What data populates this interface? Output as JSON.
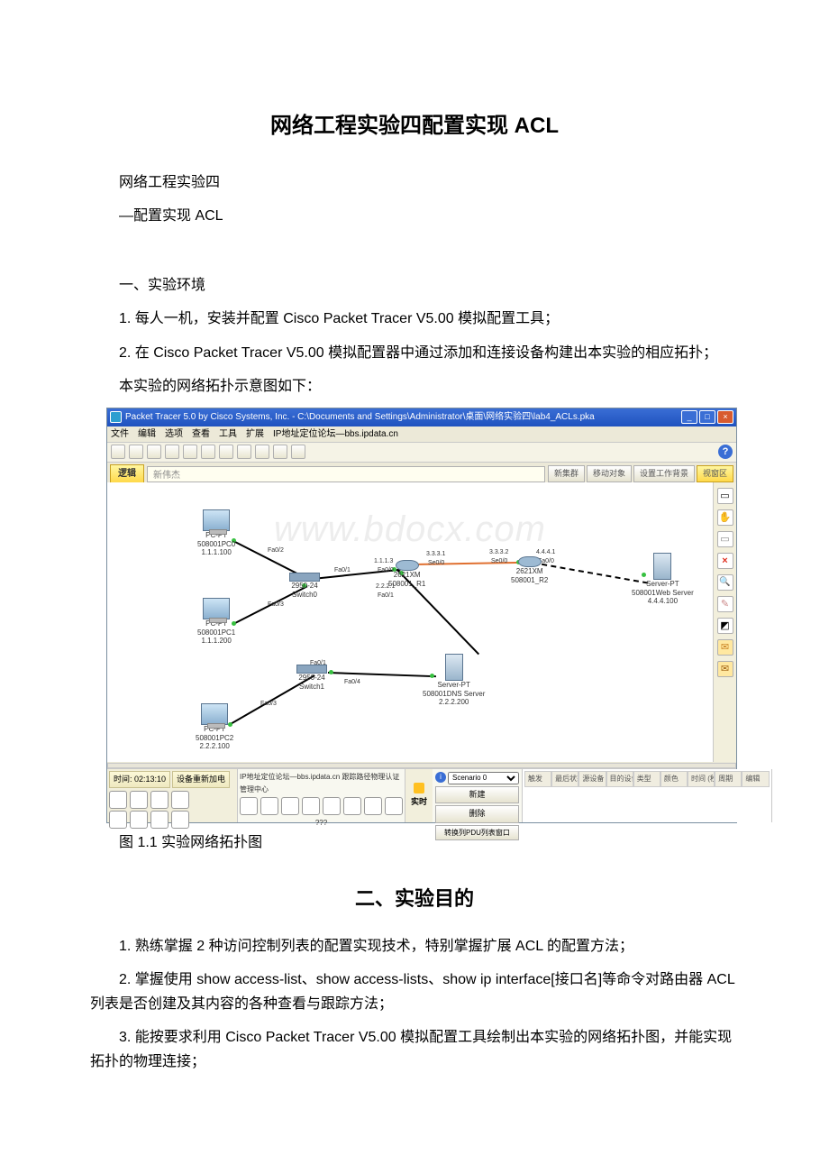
{
  "title": "网络工程实验四配置实现 ACL",
  "intro_lines": {
    "l1": "网络工程实验四",
    "l2": "—配置实现 ACL"
  },
  "section1": {
    "heading": "一、实验环境",
    "p1": "1. 每人一机，安装并配置 Cisco Packet Tracer V5.00 模拟配置工具；",
    "p2": "2. 在 Cisco Packet Tracer V5.00 模拟配置器中通过添加和连接设备构建出本实验的相应拓扑；",
    "p3": "本实验的网络拓扑示意图如下："
  },
  "figure_caption": "图 1.1 实验网络拓扑图",
  "section2": {
    "heading": "二、实验目的",
    "p1": "1. 熟练掌握 2 种访问控制列表的配置实现技术，特别掌握扩展 ACL 的配置方法；",
    "p2": "2. 掌握使用 show access-list、show access-lists、show ip interface[接口名]等命令对路由器 ACL 列表是否创建及其内容的各种查看与跟踪方法；",
    "p3": "3. 能按要求利用 Cisco Packet Tracer V5.00 模拟配置工具绘制出本实验的网络拓扑图，并能实现拓扑的物理连接；"
  },
  "screenshot": {
    "titlebar": "Packet Tracer 5.0 by Cisco Systems, Inc. - C:\\Documents and Settings\\Administrator\\桌面\\网络实验四\\lab4_ACLs.pka",
    "menubar": [
      "文件",
      "编辑",
      "选项",
      "查看",
      "工具",
      "扩展",
      "IP地址定位论坛—bbs.ipdata.cn"
    ],
    "tab_logic": "逻辑",
    "tab_field_text": "新伟杰",
    "tab_buttons": {
      "b1": "新集群",
      "b2": "移动对象",
      "b3": "设置工作背景",
      "b4": "视窗区"
    },
    "help": "?",
    "watermark": "www.bdocx.com",
    "devices": {
      "pc0": {
        "name": "PC-PT",
        "label": "508001PC0",
        "ip": "1.1.1.100"
      },
      "pc1": {
        "name": "PC-PT",
        "label": "508001PC1",
        "ip": "1.1.1.200"
      },
      "pc2": {
        "name": "PC-PT",
        "label": "508001PC2",
        "ip": "2.2.2.100"
      },
      "sw0": {
        "name": "2950-24",
        "label": "Switch0"
      },
      "sw1": {
        "name": "2950-24",
        "label": "Switch1"
      },
      "r1": {
        "name": "2621XM",
        "label": "508001_R1",
        "ip1": "1.1.1.3",
        "ip2": "2.2.2.1",
        "ip_s": "3.3.3.1"
      },
      "r2": {
        "name": "2621XM",
        "label": "508001_R2",
        "ip_s": "3.3.3.2",
        "ip_f": "4.4.4.1"
      },
      "dns": {
        "name": "Server-PT",
        "label": "508001DNS Server",
        "ip": "2.2.2.200"
      },
      "web": {
        "name": "Server-PT",
        "label": "508001Web Server",
        "ip": "4.4.4.100"
      }
    },
    "if_labels": {
      "sw0_pc0": "Fa0/2",
      "sw0_pc1": "Fa0/3",
      "sw0_r1": "Fa0/1",
      "sw1_pc2": "Fa0/3",
      "sw1_r1": "Fa0/1",
      "sw1_dns": "Fa0/4",
      "r1_f00": "Fa0/0",
      "r1_f01": "Fa0/1",
      "r1_s00": "Se0/0",
      "r2_s00": "Se0/0",
      "r2_f00": "Fa0/0"
    },
    "statusbar": {
      "time_label": "时间: 02:13:10",
      "reset": "设备重新加电",
      "ip_label": "IP地址定位论坛—bbs.ipdata.cn   跟踪路径物理认证管理中心",
      "realtime": "实时",
      "scenario": "Scenario 0",
      "scen_new": "新建",
      "scen_del": "删除",
      "toggle_pdu": "转换列PDU列表窗口",
      "table_headers": [
        "触发",
        "最后状态",
        "源设备",
        "目的设备",
        "类型",
        "颜色",
        "时间 (秒)",
        "周期",
        "编辑"
      ],
      "bottom_text": "???"
    },
    "winbtns": {
      "min": "_",
      "max": "□",
      "close": "×"
    },
    "rt_tools": {
      "del": "×"
    }
  }
}
